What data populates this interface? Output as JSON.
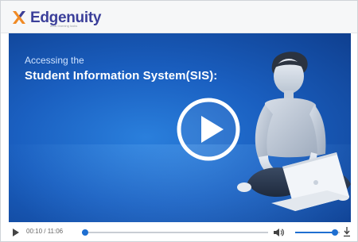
{
  "brand": {
    "name": "Edgenuity",
    "tagline": "what learning looks",
    "brand_color": "#3b3f9a",
    "accent_orange": "#f08a24"
  },
  "video": {
    "title_line1": "Accessing the",
    "title_line2": "Student Information System(SIS):",
    "background_color": "#1a5fc0",
    "play_icon": "play-circle-icon"
  },
  "controls": {
    "time_display": "00:10 / 11:06",
    "progress_fraction": 0.015,
    "volume_fraction": 0.9,
    "accent_color": "#1f6fd1",
    "icons": [
      "play-icon",
      "volume-icon",
      "download-icon"
    ]
  }
}
